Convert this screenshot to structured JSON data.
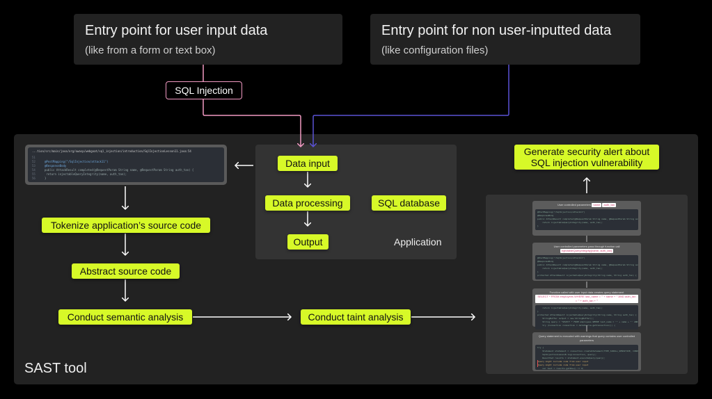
{
  "entries": {
    "user": {
      "title": "Entry point for user input data",
      "subtitle": "(like from a form or text box)"
    },
    "non_user": {
      "title": "Entry point for non user-inputted data",
      "subtitle": "(like configuration files)"
    }
  },
  "sqli_tag": "SQL Injection",
  "colors": {
    "node": "#d7f928",
    "user_path": "#f29ac3",
    "non_user_path": "#5a52d6",
    "panel": "#222222",
    "app": "#333333"
  },
  "application": {
    "label": "Application",
    "nodes": [
      "Data input",
      "Data processing",
      "Output",
      "SQL database"
    ]
  },
  "sast": {
    "label": "SAST tool",
    "steps": [
      "Tokenize application’s source code",
      "Abstract source code",
      "Conduct semantic analysis",
      "Conduct taint analysis"
    ],
    "alert": [
      "Generate security alert about",
      "SQL injection vulnerability"
    ]
  },
  "code_snippet": {
    "path": "...tion/src/main/java/org/owasp/webgoat/sql_injection/introduction/SqlInjectionLesson11.java:54",
    "lines": [
      {
        "n": "51",
        "text": ""
      },
      {
        "n": "52",
        "text": "@PostMapping(\"/SqlInjection/attack11\")"
      },
      {
        "n": "53",
        "text": "@ResponseBody"
      },
      {
        "n": "54",
        "text": "public AttackResult completed(@RequestParam String name, @RequestParam String auth_tan) {"
      },
      {
        "n": "55",
        "text": "    return injectableQueryIntegrity(name, auth_tan);"
      },
      {
        "n": "56",
        "text": "}"
      }
    ]
  },
  "evidence_cards": [
    {
      "title": "User controlled parameters",
      "pills": [
        "name",
        "auth_tan"
      ],
      "code": [
        "@PostMapping(\"/SqlInjection/attack11\")",
        "@ResponseBody",
        "public AttackResult completed(@RequestParam String name, @RequestParam String auth_tan) {",
        "    return injectableQueryIntegrity(name, auth_tan);",
        "}"
      ]
    },
    {
      "title": "User controlled parameters pass through function call",
      "pills": [
        "injectableQueryIntegrity(name, auth_tan)"
      ],
      "code": [
        "@PostMapping(\"/SqlInjection/attack11\")",
        "@ResponseBody",
        "public AttackResult completed(@RequestParam String name, @RequestParam String auth_tan) {",
        "    return injectableQueryIntegrity(name, auth_tan);",
        "}",
        "",
        "protected AttackResult injectableQueryIntegrity(String name, String auth_tan) {"
      ]
    },
    {
      "title": "Function called with user input data creates query statement",
      "pills": [
        "SELECT * FROM employees WHERE last_name = '\" + name + \"' AND auth_tan = '\" + auth_tan + \"'"
      ],
      "code": [
        "    return injectableQueryIntegrity(name, auth_tan);",
        "}",
        "",
        "protected AttackResult injectableQueryIntegrity(String name, String auth_tan) {",
        "    StringBuffer output = new StringBuffer();",
        "    String query = \"SELECT * FROM employees WHERE last_name = '\" + name + \"' AND auth_tan = '\" + auth_tan + \"'\";",
        "    try (Connection connection = dataSource.getConnection()) {"
      ]
    },
    {
      "title": "Query statement is executed with warnings that query contains user controlled parameters",
      "pills": [],
      "code": [
        "try {",
        "    Statement statement = connection.createStatement(TYPE_SCROLL_SENSITIVE, CONCUR_UPDATABLE);",
        "    SqlInjectionLesson8.log(connection, query);",
        "    ResultSet results = statement.executeQuery(query);",
        "Query might include code from user input",
        "Query might include code from user input",
        "    var test = results.getRow() != 0;",
        "    if (results.getStatement() != null) {",
        "        if (results.first()) {"
      ]
    }
  ]
}
